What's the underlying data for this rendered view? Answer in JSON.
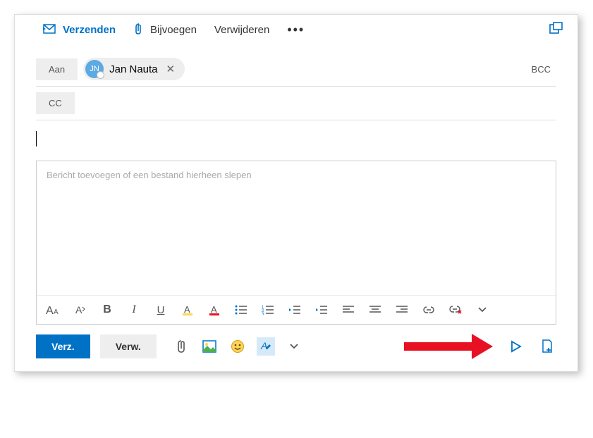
{
  "toolbar": {
    "send": "Verzenden",
    "attach": "Bijvoegen",
    "delete": "Verwijderen"
  },
  "recipients": {
    "to_label": "Aan",
    "cc_label": "CC",
    "bcc_label": "BCC",
    "to_chip": {
      "initials": "JN",
      "name": "Jan Nauta"
    }
  },
  "body": {
    "placeholder": "Bericht toevoegen of een bestand hierheen slepen"
  },
  "bottom": {
    "send_short": "Verz.",
    "delete_short": "Verw."
  }
}
